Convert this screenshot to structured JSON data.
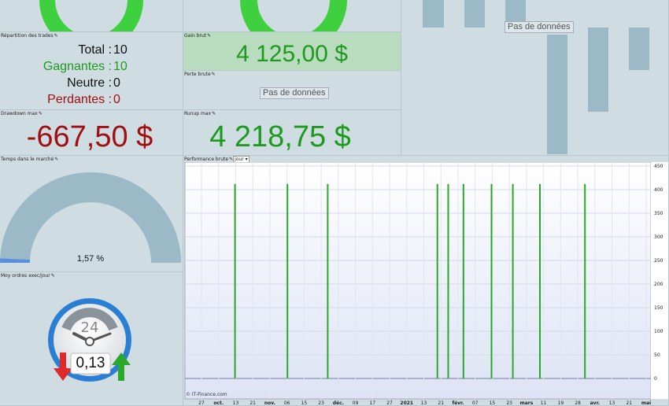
{
  "trades_panel": {
    "title": "Répartition des trades",
    "rows": [
      {
        "label": "Total :",
        "value": "10",
        "color": "#111111"
      },
      {
        "label": "Gagnantes :",
        "value": "10",
        "color": "#1e9a1e"
      },
      {
        "label": "Neutre :",
        "value": "0",
        "color": "#111111"
      },
      {
        "label": "Perdantes :",
        "value": "0",
        "color": "#a01010"
      }
    ]
  },
  "gain_panel": {
    "title": "Gain brut",
    "value": "4 125,00 $",
    "color": "#1e9a1e"
  },
  "perte_panel": {
    "title": "Perte brute",
    "nodata": "Pas de données"
  },
  "drawdown_panel": {
    "title": "Drawdown max",
    "value": "-667,50 $",
    "color": "#a01010"
  },
  "runup_panel": {
    "title": "Runup max",
    "value": "4 218,75 $",
    "color": "#1e9a1e"
  },
  "right_panel": {
    "nodata": "Pas de données"
  },
  "time_panel": {
    "title": "Temps dans le marché",
    "value": "1,57 %",
    "fraction": 0.0157
  },
  "orders_panel": {
    "title": "Moy ordres exec/jour",
    "value": "0,13",
    "clock_label": "24"
  },
  "perf_panel": {
    "title": "Performance brute",
    "dropdown": "jour",
    "credit": "© IT-Finance.com"
  },
  "chart_data": {
    "type": "bar",
    "ylim": [
      0,
      450
    ],
    "yticks": [
      0,
      50,
      100,
      150,
      200,
      250,
      300,
      350,
      400,
      450
    ],
    "bar_value": 412,
    "bar_color": "#2aa82a",
    "bar_positions": [
      0.099,
      0.254,
      0.373,
      0.697,
      0.729,
      0.774,
      0.857,
      0.92,
      1.0,
      1.133
    ],
    "xticks": [
      {
        "label": "27",
        "bold": false
      },
      {
        "label": "oct.",
        "bold": true
      },
      {
        "label": "13",
        "bold": false
      },
      {
        "label": "21",
        "bold": false
      },
      {
        "label": "nov.",
        "bold": true
      },
      {
        "label": "06",
        "bold": false
      },
      {
        "label": "15",
        "bold": false
      },
      {
        "label": "23",
        "bold": false
      },
      {
        "label": "déc.",
        "bold": true
      },
      {
        "label": "09",
        "bold": false
      },
      {
        "label": "17",
        "bold": false
      },
      {
        "label": "27",
        "bold": false
      },
      {
        "label": "2021",
        "bold": true
      },
      {
        "label": "13",
        "bold": false
      },
      {
        "label": "21",
        "bold": false
      },
      {
        "label": "févr.",
        "bold": true
      },
      {
        "label": "07",
        "bold": false
      },
      {
        "label": "15",
        "bold": false
      },
      {
        "label": "23",
        "bold": false
      },
      {
        "label": "mars",
        "bold": true
      },
      {
        "label": "11",
        "bold": false
      },
      {
        "label": "19",
        "bold": false
      },
      {
        "label": "28",
        "bold": false
      },
      {
        "label": "avr.",
        "bold": true
      },
      {
        "label": "13",
        "bold": false
      },
      {
        "label": "21",
        "bold": false
      },
      {
        "label": "mai",
        "bold": true
      }
    ]
  }
}
